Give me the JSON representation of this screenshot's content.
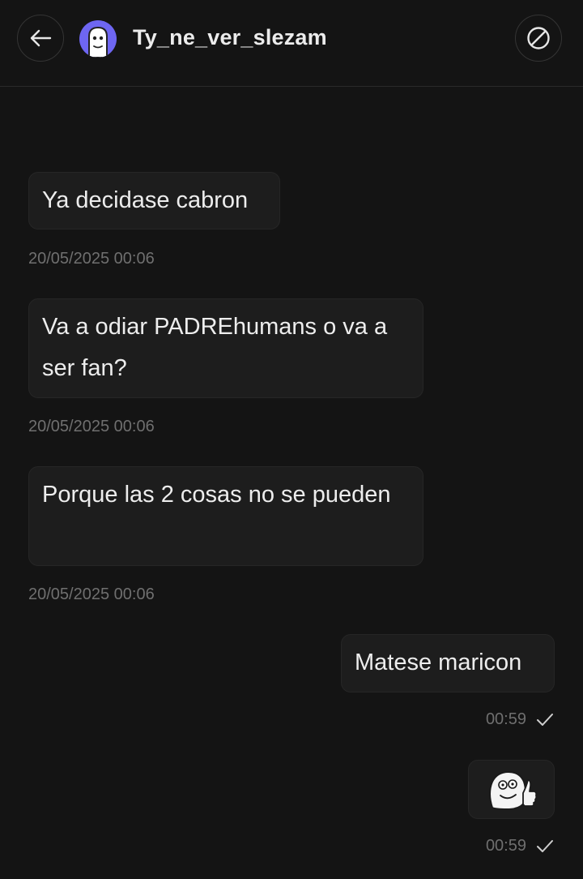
{
  "header": {
    "back_icon": "arrow-left-icon",
    "contact_name": "Ty_ne_ver_slezam",
    "avatar_icon": "ghost-avatar-icon",
    "block_icon": "block-icon"
  },
  "messages": [
    {
      "direction": "incoming",
      "text": "Ya decidase cabron",
      "timestamp": "20/05/2025 00:06"
    },
    {
      "direction": "incoming",
      "text": "Va a odiar PADREhumans o va a ser fan?",
      "timestamp": "20/05/2025 00:06"
    },
    {
      "direction": "incoming",
      "text": "Porque las 2 cosas no se pueden",
      "timestamp": "20/05/2025 00:06"
    },
    {
      "direction": "outgoing",
      "text": "Matese maricon",
      "timestamp": "00:59",
      "status_icon": "check-icon"
    },
    {
      "direction": "outgoing",
      "sticker": "thumbs-up-face-sticker",
      "timestamp": "00:59",
      "status_icon": "check-icon"
    }
  ],
  "colors": {
    "background": "#141414",
    "bubble": "#1d1d1d",
    "avatar": "#6e66f2",
    "timestamp": "#6f6f6f"
  }
}
